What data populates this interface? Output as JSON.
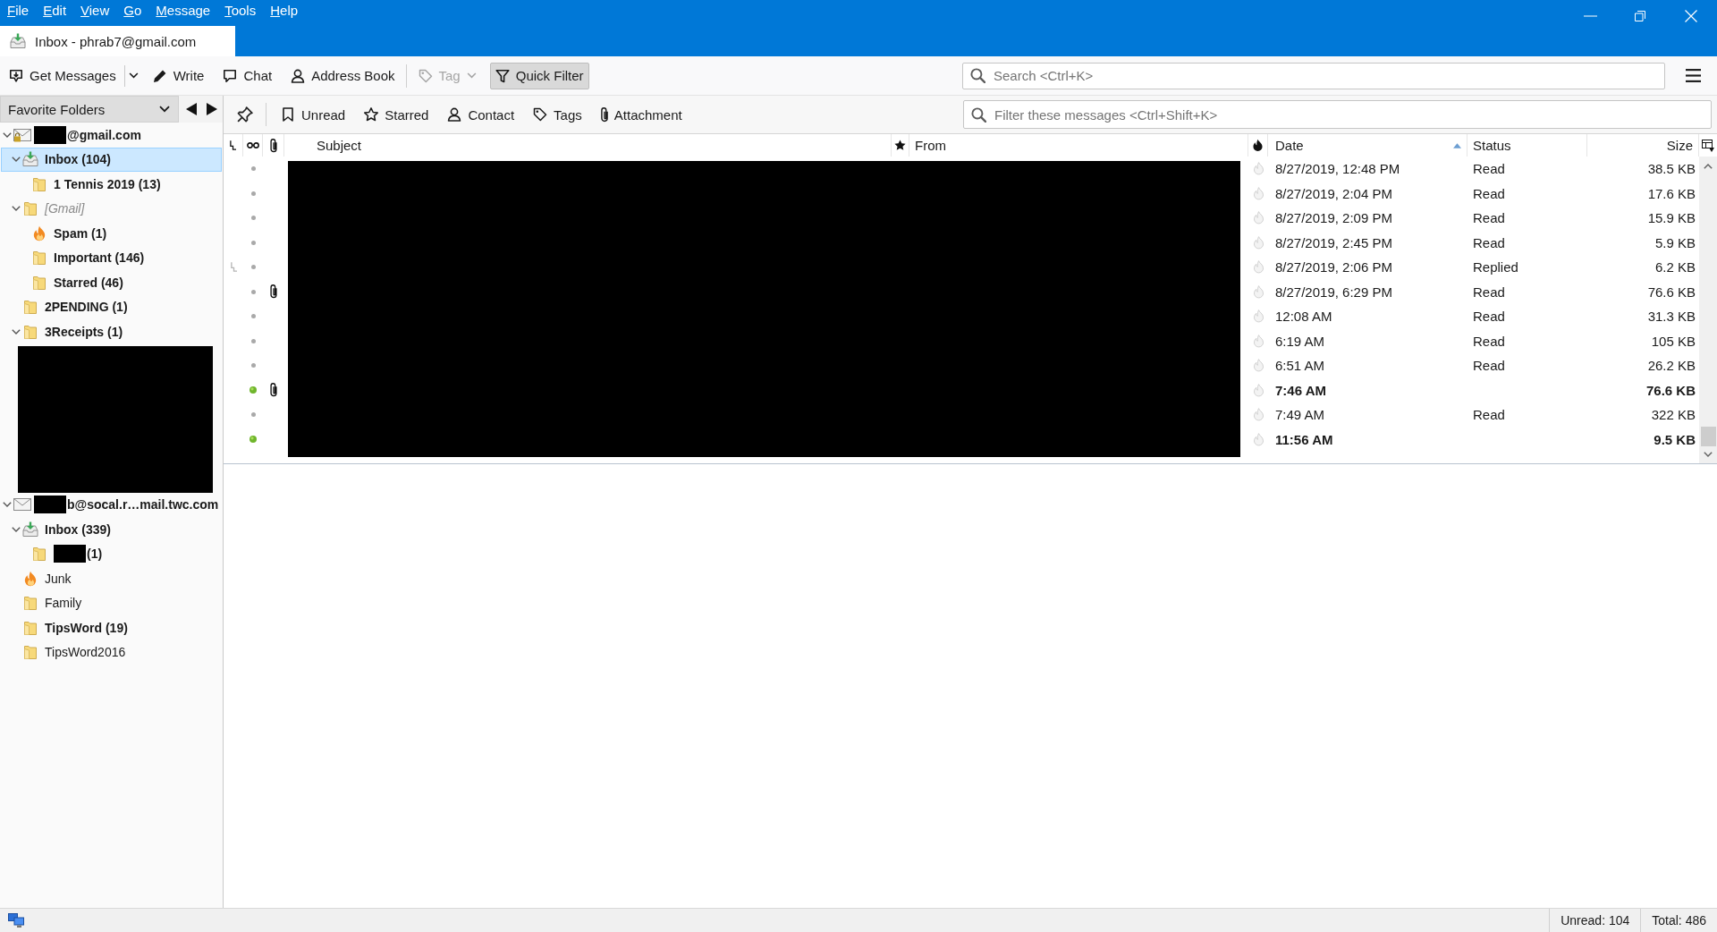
{
  "menu_bar": {
    "items": [
      "File",
      "Edit",
      "View",
      "Go",
      "Message",
      "Tools",
      "Help"
    ]
  },
  "tabs": [
    {
      "label": "Inbox - phrab7@gmail.com",
      "selected": true
    }
  ],
  "toolbar": {
    "buttons": [
      {
        "kind": "split",
        "label": "Get Messages",
        "disabled": false,
        "pressed": false
      },
      {
        "kind": "button",
        "label": "Write",
        "disabled": false,
        "pressed": false
      },
      {
        "kind": "button",
        "label": "Chat",
        "disabled": false,
        "pressed": false
      },
      {
        "kind": "button",
        "label": "Address Book",
        "disabled": false,
        "pressed": false
      },
      {
        "kind": "menu",
        "label": "Tag",
        "disabled": true,
        "pressed": false
      },
      {
        "kind": "button",
        "label": "Quick Filter",
        "disabled": false,
        "pressed": true
      }
    ],
    "search": {
      "placeholder": "Search <Ctrl+K>"
    }
  },
  "folder_pane": {
    "view_selector": "Favorite Folders",
    "folders": [
      {
        "kind": "account",
        "name": "@gmail.com",
        "redacted_prefix": true,
        "locked": true,
        "expanded": true,
        "selected": false,
        "has_unread": true,
        "disabled": false,
        "children": [
          {
            "kind": "inbox",
            "name": "Inbox (104)",
            "expanded": true,
            "selected": true,
            "has_unread": true,
            "disabled": false,
            "children": [
              {
                "kind": "folder",
                "name": "1 Tennis 2019 (13)",
                "selected": false,
                "has_unread": true,
                "disabled": false
              }
            ]
          },
          {
            "kind": "folder",
            "name": "[Gmail]",
            "expanded": true,
            "selected": false,
            "has_unread": false,
            "disabled": true,
            "children": [
              {
                "kind": "junk",
                "name": "Spam (1)",
                "selected": false,
                "has_unread": true,
                "disabled": false
              },
              {
                "kind": "folder",
                "name": "Important (146)",
                "selected": false,
                "has_unread": true,
                "disabled": false
              },
              {
                "kind": "folder",
                "name": "Starred (46)",
                "selected": false,
                "has_unread": true,
                "disabled": false
              }
            ]
          },
          {
            "kind": "folder",
            "name": "2PENDING (1)",
            "selected": false,
            "has_unread": true,
            "disabled": false
          },
          {
            "kind": "folder",
            "name": "3Receipts (1)",
            "expanded": true,
            "children_redacted": true,
            "selected": false,
            "has_unread": true,
            "disabled": false
          }
        ]
      },
      {
        "kind": "account",
        "name": "b@socal.r…mail.twc.com",
        "redacted_prefix": true,
        "locked": false,
        "expanded": true,
        "selected": false,
        "has_unread": true,
        "disabled": false,
        "children": [
          {
            "kind": "inbox",
            "name": "Inbox (339)",
            "expanded": true,
            "selected": false,
            "has_unread": true,
            "disabled": false,
            "children": [
              {
                "kind": "folder",
                "name": "(1)",
                "redacted_prefix": true,
                "selected": false,
                "has_unread": true,
                "disabled": false
              }
            ]
          },
          {
            "kind": "junk",
            "name": "Junk",
            "selected": false,
            "has_unread": false,
            "disabled": false
          },
          {
            "kind": "folder",
            "name": "Family",
            "selected": false,
            "has_unread": false,
            "disabled": false
          },
          {
            "kind": "folder",
            "name": "TipsWord (19)",
            "selected": false,
            "has_unread": true,
            "disabled": false
          },
          {
            "kind": "folder",
            "name": "TipsWord2016",
            "selected": false,
            "has_unread": false,
            "disabled": false
          }
        ]
      }
    ]
  },
  "quick_filter": {
    "buttons": [
      {
        "label": "Unread",
        "on": false
      },
      {
        "label": "Starred",
        "on": false
      },
      {
        "label": "Contact",
        "on": false
      },
      {
        "label": "Tags",
        "on": false
      },
      {
        "label": "Attachment",
        "on": false
      }
    ],
    "filter_field": {
      "placeholder": "Filter these messages <Ctrl+Shift+K>"
    }
  },
  "message_list": {
    "columns": [
      {
        "label": "Subject",
        "sorted": false
      },
      {
        "label": "From",
        "sorted": false
      },
      {
        "label": "Date",
        "sorted": true
      },
      {
        "label": "Status",
        "sorted": false
      },
      {
        "label": "Size",
        "sorted": false
      }
    ],
    "redacted": true,
    "rows": [
      {
        "unread": false,
        "attachment": false,
        "in_thread": false,
        "date": "8/27/2019, 12:48 PM",
        "status": "Read",
        "size": "38.5 KB"
      },
      {
        "unread": false,
        "attachment": false,
        "in_thread": false,
        "date": "8/27/2019, 2:04 PM",
        "status": "Read",
        "size": "17.6 KB"
      },
      {
        "unread": false,
        "attachment": false,
        "in_thread": false,
        "date": "8/27/2019, 2:09 PM",
        "status": "Read",
        "size": "15.9 KB"
      },
      {
        "unread": false,
        "attachment": false,
        "in_thread": false,
        "date": "8/27/2019, 2:45 PM",
        "status": "Read",
        "size": "5.9 KB"
      },
      {
        "unread": false,
        "attachment": false,
        "in_thread": true,
        "date": "8/27/2019, 2:06 PM",
        "status": "Replied",
        "size": "6.2 KB"
      },
      {
        "unread": false,
        "attachment": true,
        "in_thread": false,
        "date": "8/27/2019, 6:29 PM",
        "status": "Read",
        "size": "76.6 KB"
      },
      {
        "unread": false,
        "attachment": false,
        "in_thread": false,
        "date": "12:08 AM",
        "status": "Read",
        "size": "31.3 KB"
      },
      {
        "unread": false,
        "attachment": false,
        "in_thread": false,
        "date": "6:19 AM",
        "status": "Read",
        "size": "105 KB"
      },
      {
        "unread": false,
        "attachment": false,
        "in_thread": false,
        "date": "6:51 AM",
        "status": "Read",
        "size": "26.2 KB"
      },
      {
        "unread": true,
        "attachment": true,
        "in_thread": false,
        "date": "7:46 AM",
        "size": "76.6 KB"
      },
      {
        "unread": false,
        "attachment": false,
        "in_thread": false,
        "date": "7:49 AM",
        "status": "Read",
        "size": "322 KB"
      },
      {
        "unread": true,
        "attachment": false,
        "in_thread": false,
        "date": "11:56 AM",
        "size": "9.5 KB"
      }
    ]
  },
  "status_bar": {
    "unread": "Unread: 104",
    "total": "Total: 486"
  }
}
